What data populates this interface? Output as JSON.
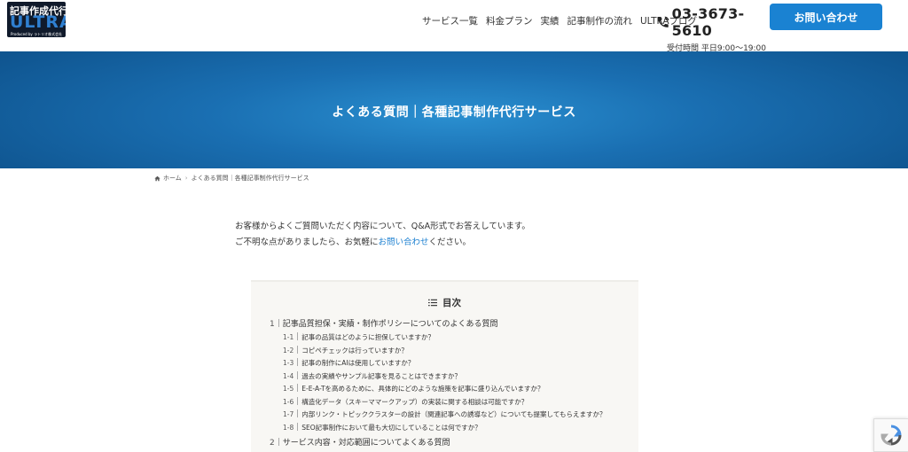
{
  "logo": {
    "top_text": "記事作成代行",
    "main_text": "ULTRA",
    "sub_text": "Produced by ラトリオ株式会社"
  },
  "nav": {
    "items": [
      "サービス一覧",
      "料金プラン",
      "実績",
      "記事制作の流れ",
      "ULTRAブログ"
    ]
  },
  "phone": {
    "number": "03-3673-5610",
    "hours": "受付時間 平日9:00〜19:00"
  },
  "contact_button": "お問い合わせ",
  "hero": {
    "title": "よくある質問｜各種記事制作代行サービス"
  },
  "breadcrumb": {
    "home": "ホーム",
    "current": "よくある質問｜各種記事制作代行サービス"
  },
  "intro": {
    "line1": "お客様からよくご質問いただく内容について、Q&A形式でお答えしています。",
    "line2_before": "ご不明な点がありましたら、お気軽に",
    "line2_link": "お問い合わせ",
    "line2_after": "ください。"
  },
  "toc": {
    "title": "目次",
    "sections": [
      {
        "num": "1",
        "label": "記事品質担保・実績・制作ポリシーについてのよくある質問",
        "items": [
          {
            "num": "1-1",
            "label": "記事の品質はどのように担保していますか？"
          },
          {
            "num": "1-2",
            "label": "コピペチェックは行っていますか？"
          },
          {
            "num": "1-3",
            "label": "記事の制作にAIは使用していますか？"
          },
          {
            "num": "1-4",
            "label": "過去の実績やサンプル記事を見ることはできますか？"
          },
          {
            "num": "1-5",
            "label": "E-E-A-Tを高めるために、具体的にどのような施策を記事に盛り込んでいますか？"
          },
          {
            "num": "1-6",
            "label": "構造化データ（スキーママークアップ）の実装に関する相談は可能ですか？"
          },
          {
            "num": "1-7",
            "label": "内部リンク・トピッククラスターの設計（関連記事への誘導など）についても提案してもらえますか？"
          },
          {
            "num": "1-8",
            "label": "SEO記事制作において最も大切にしていることは何ですか？"
          }
        ]
      },
      {
        "num": "2",
        "label": "サービス内容・対応範囲についてよくある質問",
        "items": []
      }
    ]
  },
  "colors": {
    "accent": "#1a82d2",
    "hero": "#1a6fb2",
    "logo_bg": "#101a2b"
  }
}
